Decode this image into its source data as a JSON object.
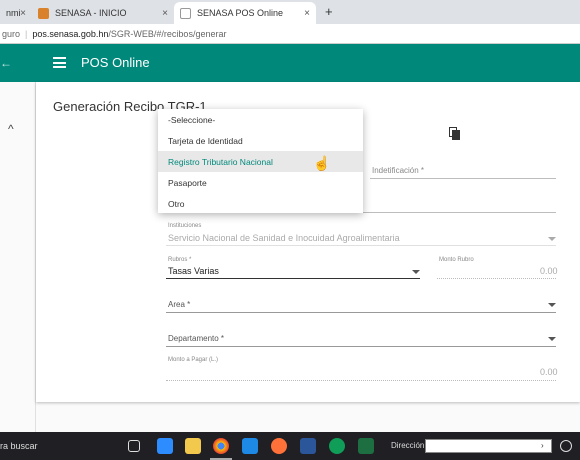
{
  "browser": {
    "tabs": [
      {
        "label": "nmi",
        "close": "×"
      },
      {
        "label": "SENASA - INICIO",
        "close": "×"
      },
      {
        "label": "SENASA POS Online",
        "close": "×"
      }
    ],
    "new_tab": "+",
    "address": {
      "prefix": "guro",
      "host": "pos.senasa.gob.hn",
      "path": "/SGR-WEB/#/recibos/generar"
    }
  },
  "appbar": {
    "back_arrow": "←",
    "title": "POS Online"
  },
  "page": {
    "title": "Generación Recibo TGR-1",
    "identification_label": "Indetificación *",
    "instituciones_label": "Instituciones",
    "instituciones_value": "Servicio Nacional de Sanidad e Inocuidad Agroalimentaria",
    "rubros_label": "Rubros *",
    "rubros_value": "Tasas Varias",
    "monto_rubro_label": "Monto Rubro",
    "monto_rubro_value": "0.00",
    "area_label": "Area *",
    "departamento_label": "Departamento *",
    "monto_pagar_label": "Monto a Pagar (L.)",
    "monto_pagar_value": "0.00"
  },
  "dropdown": {
    "options": [
      "-Seleccione-",
      "Tarjeta de Identidad",
      "Registro Tributario Nacional",
      "Pasaporte",
      "Otro"
    ],
    "highlighted_index": 2
  },
  "taskbar": {
    "search_text": "ra buscar",
    "direccion_label": "Dirección"
  },
  "colors": {
    "accent": "#00897b",
    "highlight": "#e8e8e8"
  }
}
